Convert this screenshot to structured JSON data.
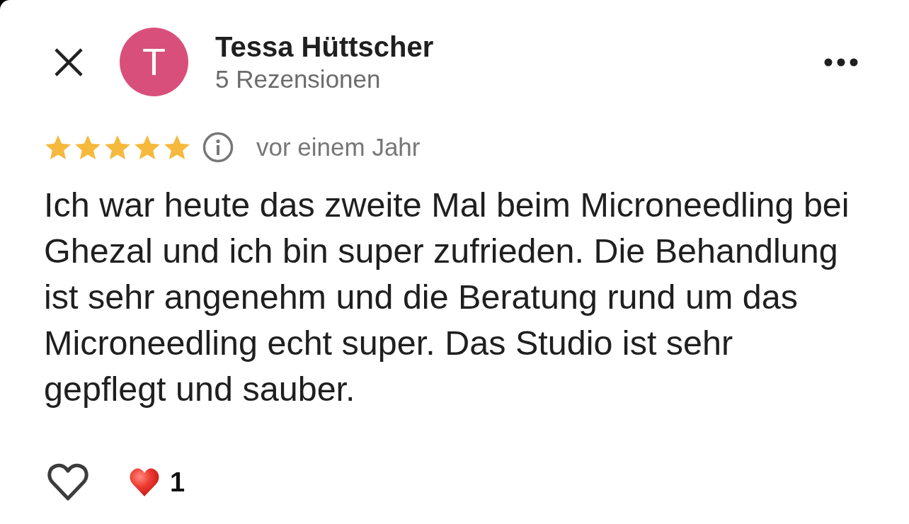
{
  "reviewer": {
    "initial": "T",
    "name": "Tessa Hüttscher",
    "review_count": "5 Rezensionen"
  },
  "review": {
    "stars": 5,
    "time": "vor einem Jahr",
    "text": "Ich war heute das zweite Mal beim Microneedling bei Ghezal und ich bin super zufrieden. Die Behandlung ist sehr angenehm und die Beratung rund um das Microneedling echt super. Das Studio ist sehr gepflegt und sauber."
  },
  "actions": {
    "liked": false,
    "reaction_count": "1"
  }
}
